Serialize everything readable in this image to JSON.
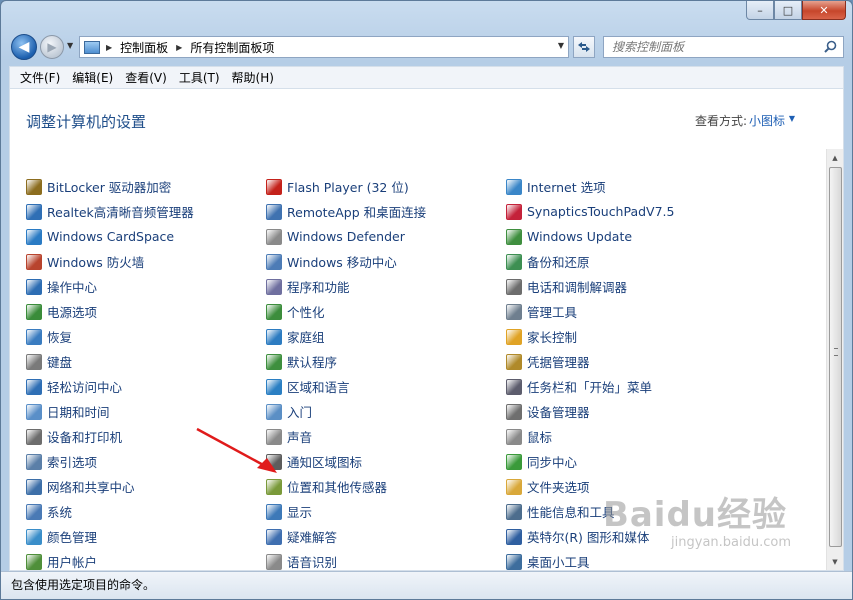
{
  "window": {
    "caption_buttons": {
      "minimize": "–",
      "maximize": "□",
      "close": "✕"
    }
  },
  "nav": {
    "back_glyph": "◀",
    "forward_glyph": "▶",
    "breadcrumbs": [
      "控制面板",
      "所有控制面板项"
    ],
    "search_placeholder": "搜索控制面板"
  },
  "menu": [
    {
      "label": "文件(F)"
    },
    {
      "label": "编辑(E)"
    },
    {
      "label": "查看(V)"
    },
    {
      "label": "工具(T)"
    },
    {
      "label": "帮助(H)"
    }
  ],
  "header": {
    "title": "调整计算机的设置",
    "view_label": "查看方式:",
    "view_value": "小图标"
  },
  "columns": [
    [
      {
        "label": "BitLocker 驱动器加密",
        "icon": "bitlocker-icon",
        "color": "#8c6d1f"
      },
      {
        "label": "Realtek高清晰音频管理器",
        "icon": "realtek-audio-icon",
        "color": "#2f6fb5"
      },
      {
        "label": "Windows CardSpace",
        "icon": "cardspace-icon",
        "color": "#2a7bc4"
      },
      {
        "label": "Windows 防火墙",
        "icon": "firewall-icon",
        "color": "#b8442e"
      },
      {
        "label": "操作中心",
        "icon": "action-center-icon",
        "color": "#2d6db3"
      },
      {
        "label": "电源选项",
        "icon": "power-options-icon",
        "color": "#3a8c3a"
      },
      {
        "label": "恢复",
        "icon": "recovery-icon",
        "color": "#3a7cc0"
      },
      {
        "label": "键盘",
        "icon": "keyboard-icon",
        "color": "#7a7a7a"
      },
      {
        "label": "轻松访问中心",
        "icon": "ease-of-access-icon",
        "color": "#2f6fb5"
      },
      {
        "label": "日期和时间",
        "icon": "date-time-icon",
        "color": "#5a8fc8"
      },
      {
        "label": "设备和打印机",
        "icon": "devices-printers-icon",
        "color": "#6d6d6d"
      },
      {
        "label": "索引选项",
        "icon": "indexing-icon",
        "color": "#5b7fa8"
      },
      {
        "label": "网络和共享中心",
        "icon": "network-icon",
        "color": "#3d6fa8"
      },
      {
        "label": "系统",
        "icon": "system-icon",
        "color": "#4a7ab5"
      },
      {
        "label": "颜色管理",
        "icon": "color-management-icon",
        "color": "#3a8ec9"
      },
      {
        "label": "用户帐户",
        "icon": "user-accounts-icon",
        "color": "#4f8f3a"
      }
    ],
    [
      {
        "label": "Flash Player (32 位)",
        "icon": "flash-player-icon",
        "color": "#c4221b"
      },
      {
        "label": "RemoteApp 和桌面连接",
        "icon": "remoteapp-icon",
        "color": "#3f72b0"
      },
      {
        "label": "Windows Defender",
        "icon": "defender-icon",
        "color": "#8a8a8a"
      },
      {
        "label": "Windows 移动中心",
        "icon": "mobility-center-icon",
        "color": "#4d7cb6"
      },
      {
        "label": "程序和功能",
        "icon": "programs-features-icon",
        "color": "#6f6f9f"
      },
      {
        "label": "个性化",
        "icon": "personalization-icon",
        "color": "#3c8d3c"
      },
      {
        "label": "家庭组",
        "icon": "homegroup-icon",
        "color": "#2d7cc1"
      },
      {
        "label": "默认程序",
        "icon": "default-programs-icon",
        "color": "#3e8f3e"
      },
      {
        "label": "区域和语言",
        "icon": "region-language-icon",
        "color": "#2b7fc3"
      },
      {
        "label": "入门",
        "icon": "getting-started-icon",
        "color": "#5b8fc5"
      },
      {
        "label": "声音",
        "icon": "sound-icon",
        "color": "#8a8a8a"
      },
      {
        "label": "通知区域图标",
        "icon": "notification-icons-icon",
        "color": "#5d5d5d"
      },
      {
        "label": "位置和其他传感器",
        "icon": "location-sensors-icon",
        "color": "#7a9a3a"
      },
      {
        "label": "显示",
        "icon": "display-icon",
        "color": "#3d79b8"
      },
      {
        "label": "疑难解答",
        "icon": "troubleshooting-icon",
        "color": "#3f6fb0"
      },
      {
        "label": "语音识别",
        "icon": "speech-recognition-icon",
        "color": "#8a8a8a"
      }
    ],
    [
      {
        "label": "Internet 选项",
        "icon": "internet-options-icon",
        "color": "#3a86c8"
      },
      {
        "label": "SynapticsTouchPadV7.5",
        "icon": "synaptics-icon",
        "color": "#c4223a"
      },
      {
        "label": "Windows Update",
        "icon": "windows-update-icon",
        "color": "#3f8f3f"
      },
      {
        "label": "备份和还原",
        "icon": "backup-restore-icon",
        "color": "#3d8f52"
      },
      {
        "label": "电话和调制解调器",
        "icon": "phone-modem-icon",
        "color": "#6d6d6d"
      },
      {
        "label": "管理工具",
        "icon": "admin-tools-icon",
        "color": "#6f7f8f"
      },
      {
        "label": "家长控制",
        "icon": "parental-controls-icon",
        "color": "#e0a325"
      },
      {
        "label": "凭据管理器",
        "icon": "credential-manager-icon",
        "color": "#b08a2a"
      },
      {
        "label": "任务栏和「开始」菜单",
        "icon": "taskbar-start-icon",
        "color": "#5d5d6d"
      },
      {
        "label": "设备管理器",
        "icon": "device-manager-icon",
        "color": "#6f6f6f"
      },
      {
        "label": "鼠标",
        "icon": "mouse-icon",
        "color": "#8a8a8a"
      },
      {
        "label": "同步中心",
        "icon": "sync-center-icon",
        "color": "#3a9a3a"
      },
      {
        "label": "文件夹选项",
        "icon": "folder-options-icon",
        "color": "#d9a83a"
      },
      {
        "label": "性能信息和工具",
        "icon": "performance-icon",
        "color": "#4d6d8d"
      },
      {
        "label": "英特尔(R) 图形和媒体",
        "icon": "intel-graphics-icon",
        "color": "#2f5fa0"
      },
      {
        "label": "桌面小工具",
        "icon": "gadgets-icon",
        "color": "#3d6d9d"
      }
    ]
  ],
  "status": {
    "text": "包含使用选定项目的命令。"
  },
  "watermark": {
    "text": "Baidu经验",
    "sub": "jingyan.baidu.com"
  }
}
